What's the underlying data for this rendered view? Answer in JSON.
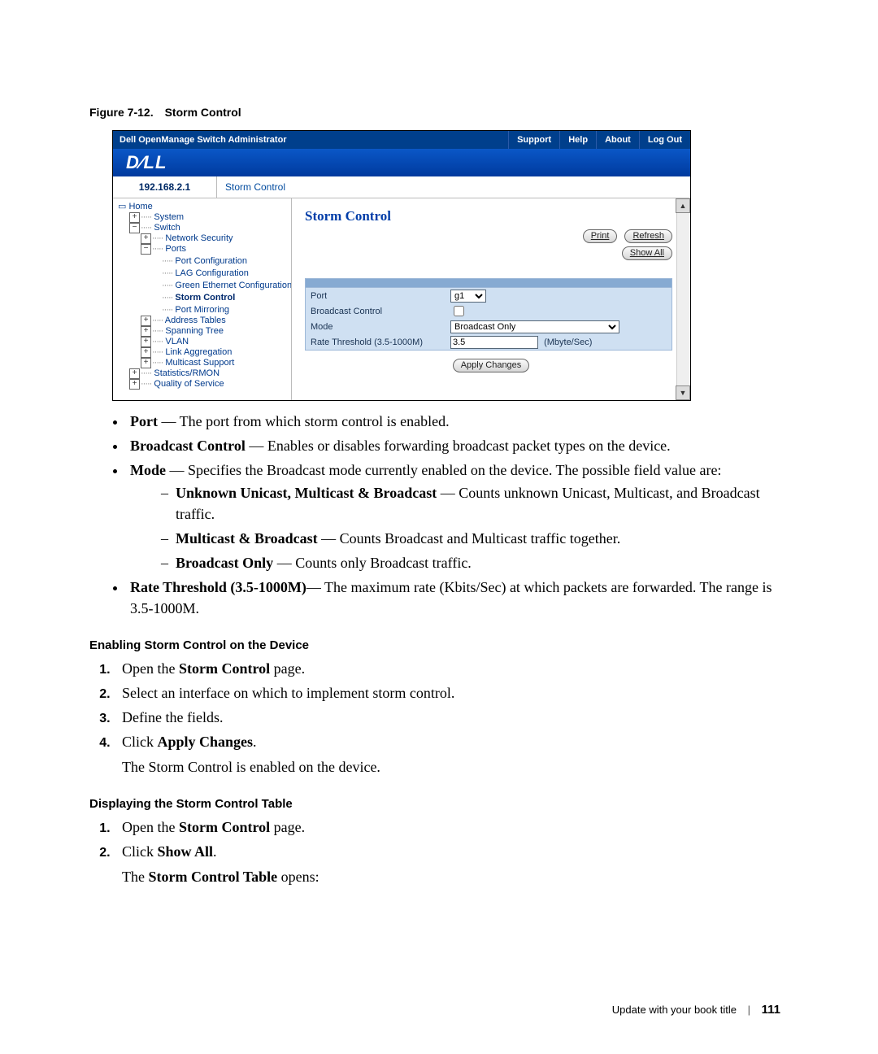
{
  "caption": {
    "label": "Figure 7-12.",
    "title": "Storm Control"
  },
  "screenshot": {
    "app_title": "Dell OpenManage Switch Administrator",
    "top_links": [
      "Support",
      "Help",
      "About",
      "Log Out"
    ],
    "logo_text": "D∕LL",
    "ip": "192.168.2.1",
    "breadcrumb": "Storm Control",
    "nav": [
      {
        "indent": 0,
        "glyph": "home",
        "label": "Home"
      },
      {
        "indent": 1,
        "glyph": "plus",
        "label": "System"
      },
      {
        "indent": 1,
        "glyph": "minus",
        "label": "Switch"
      },
      {
        "indent": 2,
        "glyph": "plus",
        "label": "Network Security"
      },
      {
        "indent": 2,
        "glyph": "minus",
        "label": "Ports"
      },
      {
        "indent": 3,
        "glyph": "none",
        "label": "Port Configuration"
      },
      {
        "indent": 3,
        "glyph": "none",
        "label": "LAG Configuration"
      },
      {
        "indent": 3,
        "glyph": "none",
        "label": "Green Ethernet Configuration"
      },
      {
        "indent": 3,
        "glyph": "none",
        "label": "Storm Control",
        "bold": true
      },
      {
        "indent": 3,
        "glyph": "none",
        "label": "Port Mirroring"
      },
      {
        "indent": 2,
        "glyph": "plus",
        "label": "Address Tables"
      },
      {
        "indent": 2,
        "glyph": "plus",
        "label": "Spanning Tree"
      },
      {
        "indent": 2,
        "glyph": "plus",
        "label": "VLAN"
      },
      {
        "indent": 2,
        "glyph": "plus",
        "label": "Link Aggregation"
      },
      {
        "indent": 2,
        "glyph": "plus",
        "label": "Multicast Support"
      },
      {
        "indent": 1,
        "glyph": "plus",
        "label": "Statistics/RMON"
      },
      {
        "indent": 1,
        "glyph": "plus",
        "label": "Quality of Service"
      }
    ],
    "content": {
      "title": "Storm Control",
      "buttons": {
        "print": "Print",
        "refresh": "Refresh",
        "showall": "Show All",
        "apply": "Apply Changes"
      },
      "form": {
        "port_label": "Port",
        "port_value": "g1",
        "bcast_label": "Broadcast Control",
        "mode_label": "Mode",
        "mode_value": "Broadcast Only",
        "rate_label": "Rate Threshold (3.5-1000M)",
        "rate_value": "3.5",
        "rate_unit": "(Mbyte/Sec)"
      }
    }
  },
  "bullets": {
    "port": {
      "term": "Port",
      "text": " — The port from which storm control is enabled."
    },
    "bcast": {
      "term": "Broadcast Control",
      "text": " — Enables or disables forwarding broadcast packet types on the device."
    },
    "mode": {
      "term": "Mode",
      "text": " — Specifies the Broadcast mode currently enabled on the device. The possible field value are:"
    },
    "mode_sub": [
      {
        "term": "Unknown Unicast, Multicast & Broadcast",
        "text": " — Counts unknown Unicast, Multicast, and Broadcast traffic."
      },
      {
        "term": "Multicast & Broadcast",
        "text": " — Counts Broadcast and Multicast traffic together."
      },
      {
        "term": "Broadcast Only",
        "text": " — Counts only Broadcast traffic."
      }
    ],
    "rate": {
      "term": "Rate Threshold (3.5-1000M)",
      "text": "— The maximum rate (Kbits/Sec) at which packets are forwarded. The range is 3.5-1000M."
    }
  },
  "sec1": {
    "title": "Enabling Storm Control on the Device",
    "steps": [
      {
        "pre": "Open the ",
        "b": "Storm Control",
        "post": " page."
      },
      {
        "pre": "Select an interface on which to implement storm control.",
        "b": "",
        "post": ""
      },
      {
        "pre": "Define the fields.",
        "b": "",
        "post": ""
      },
      {
        "pre": "Click ",
        "b": "Apply Changes",
        "post": "."
      }
    ],
    "after": "The Storm Control is enabled on the device."
  },
  "sec2": {
    "title": "Displaying the Storm Control Table",
    "steps": [
      {
        "pre": "Open the ",
        "b": "Storm Control",
        "post": " page."
      },
      {
        "pre": "Click ",
        "b": "Show All",
        "post": "."
      }
    ],
    "after_pre": "The ",
    "after_b": "Storm Control Table",
    "after_post": " opens:"
  },
  "footer": {
    "title": "Update with your book title",
    "page": "111"
  }
}
